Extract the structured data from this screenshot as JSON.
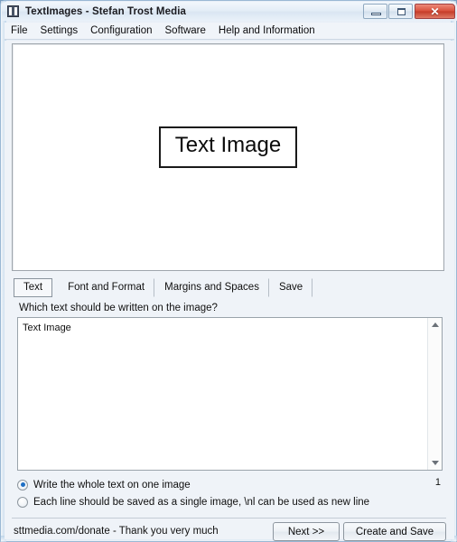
{
  "window": {
    "title": "TextImages - Stefan Trost Media",
    "icon": "app-icon",
    "caption_buttons": {
      "minimize": "minimize-icon",
      "maximize": "maximize-icon",
      "close": "✕"
    }
  },
  "menubar": {
    "items": [
      {
        "label": "File"
      },
      {
        "label": "Settings"
      },
      {
        "label": "Configuration"
      },
      {
        "label": "Software"
      },
      {
        "label": "Help and Information"
      }
    ]
  },
  "preview": {
    "image_text": "Text Image"
  },
  "tabs": [
    {
      "label": "Text",
      "active": true
    },
    {
      "label": "Font and Format",
      "active": false
    },
    {
      "label": "Margins and Spaces",
      "active": false
    },
    {
      "label": "Save",
      "active": false
    }
  ],
  "form": {
    "question_label": "Which text should be written on the image?",
    "textarea_value": "Text Image",
    "textarea_placeholder": "",
    "scroll_up_icon": "triangle-up-icon",
    "scroll_down_icon": "triangle-down-icon"
  },
  "options": {
    "radio_one_image": "Write the whole text on one image",
    "radio_per_line": "Each line should be saved as a single image, \\nl can be used as new line",
    "selected": "one_image",
    "image_count": "1"
  },
  "statusbar": {
    "donate_text": "sttmedia.com/donate - Thank you very much"
  },
  "buttons": {
    "next": "Next >>",
    "create_and_save": "Create and Save"
  },
  "colors": {
    "accent_radio": "#1f6fc4",
    "close_button": "#c43b28",
    "window_bg": "#eff3f8",
    "desktop_bg": "#8fb0cc"
  }
}
